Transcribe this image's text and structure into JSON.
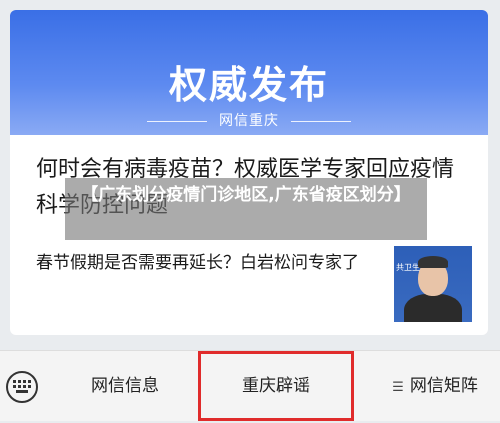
{
  "card": {
    "banner_title": "权威发布",
    "banner_source": "网信重庆",
    "headline": "何时会有病毒疫苗？权威医学专家回应疫情科学防控问题",
    "item_text": "春节假期是否需要再延长？白岩松问专家了",
    "thumb_label": "共卫生"
  },
  "overlay": {
    "caption": "【广东划分疫情门诊地区,广东省疫区划分】"
  },
  "bottom_bar": {
    "tabs": [
      {
        "label": "网信信息"
      },
      {
        "label": "重庆辟谣"
      },
      {
        "label": "网信矩阵"
      }
    ],
    "keyboard_icon": "keyboard-icon",
    "menu_icon": "menu-icon",
    "highlight_color": "#e02b2b"
  },
  "colors": {
    "banner": "#3a6fe6",
    "overlay": "rgba(120,120,120,0.62)"
  }
}
